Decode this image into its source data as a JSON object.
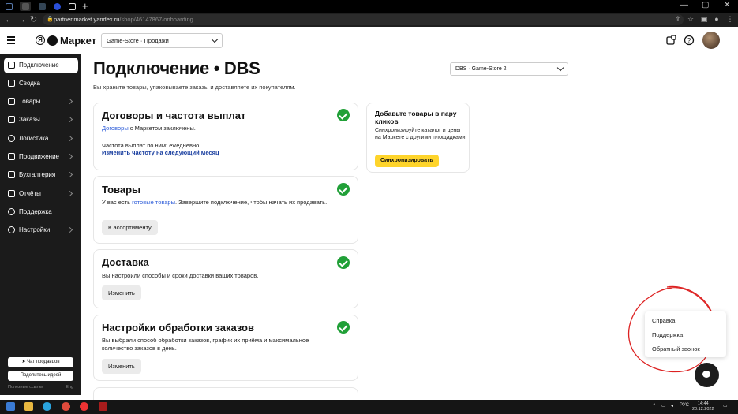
{
  "browser": {
    "url_host": "partner.market.yandex.ru",
    "url_path": "/shop/46147867/onboarding"
  },
  "header": {
    "logo_text": "Маркет",
    "store_select": "Game-Store · Продажи"
  },
  "sidebar": {
    "items": [
      {
        "label": "Подключение",
        "active": true,
        "arrow": false
      },
      {
        "label": "Сводка",
        "active": false,
        "arrow": false
      },
      {
        "label": "Товары",
        "active": false,
        "arrow": true
      },
      {
        "label": "Заказы",
        "active": false,
        "arrow": true
      },
      {
        "label": "Логистика",
        "active": false,
        "arrow": true
      },
      {
        "label": "Продвижение",
        "active": false,
        "arrow": true
      },
      {
        "label": "Бухгалтерия",
        "active": false,
        "arrow": true
      },
      {
        "label": "Отчёты",
        "active": false,
        "arrow": true
      },
      {
        "label": "Поддержка",
        "active": false,
        "arrow": false
      },
      {
        "label": "Настройки",
        "active": false,
        "arrow": true
      }
    ],
    "chat_sellers": "Чат продавцов",
    "share_idea": "Поделитесь идеей",
    "useful_links": "Полезные ссылки",
    "lang": "Eng"
  },
  "main": {
    "title": "Подключение • DBS",
    "subtitle": "Вы храните товары, упаковываете заказы и доставляете их покупателям.",
    "dbs_select": "DBS · Game-Store 2",
    "contracts": {
      "title": "Договоры и частота выплат",
      "link": "Договоры",
      "text_after_link": " с Маркетом заключены.",
      "payout_text": "Частота выплат по ним: ежедневно.",
      "change_link": "Изменить частоту на следующий месяц"
    },
    "goods": {
      "title": "Товары",
      "text_before": "У вас есть ",
      "link": "готовые товары",
      "text_after": ". Завершите подключение, чтобы начать их продавать.",
      "button": "К ассортименту"
    },
    "delivery": {
      "title": "Доставка",
      "text": "Вы настроили способы и сроки доставки ваших товаров.",
      "button": "Изменить"
    },
    "order_settings": {
      "title": "Настройки обработки заказов",
      "text": "Вы выбрали способ обработки заказов, график их приёма и максимальное количество заказов в день.",
      "button": "Изменить"
    },
    "sync": {
      "title": "Добавьте товары в пару кликов",
      "text": "Синхронизируйте каталог и цены на Маркете с другими площадками",
      "button": "Синхронизировать"
    }
  },
  "help_menu": {
    "items": [
      "Справка",
      "Поддержка",
      "Обратный звонок"
    ]
  },
  "taskbar": {
    "lang": "РУС",
    "time": "14:44",
    "date": "20.12.2022"
  }
}
